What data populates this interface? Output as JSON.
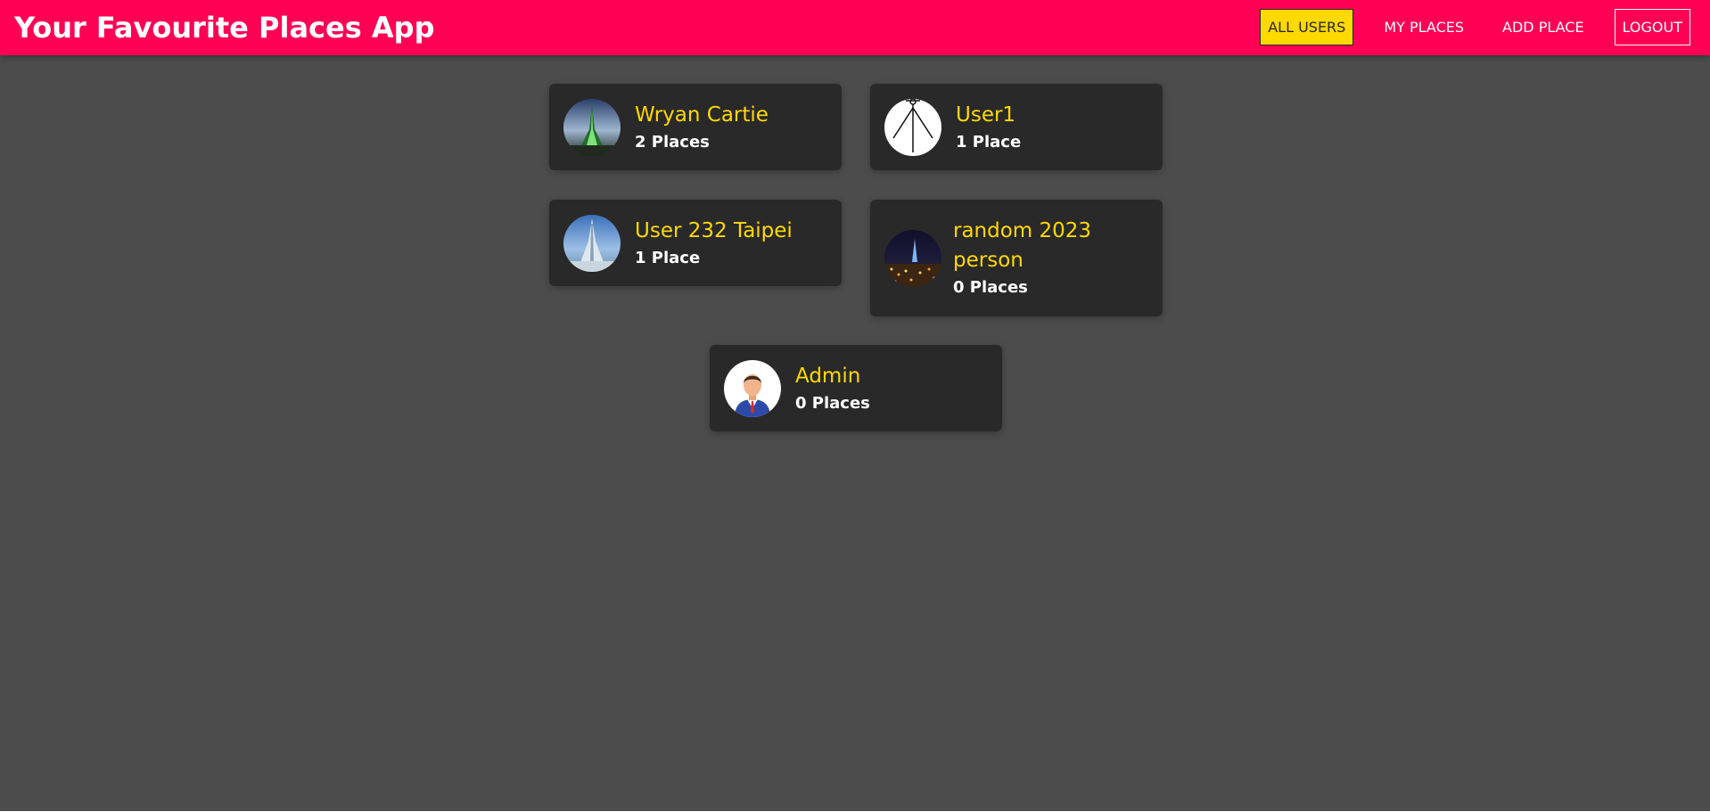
{
  "header": {
    "title": "Your Favourite Places App",
    "nav": [
      {
        "label": "ALL USERS"
      },
      {
        "label": "MY PLACES"
      },
      {
        "label": "ADD PLACE"
      },
      {
        "label": "LOGOUT"
      }
    ]
  },
  "users": [
    {
      "name": "Wryan Cartie",
      "places": "2 Places",
      "avatar": "night-tower-photo"
    },
    {
      "name": "User1",
      "places": "1 Place",
      "avatar": "stick-drawing"
    },
    {
      "name": "User 232 Taipei",
      "places": "1 Place",
      "avatar": "tower-sky-photo"
    },
    {
      "name": "random 2023 person",
      "places": "0 Places",
      "avatar": "city-night-photo"
    },
    {
      "name": "Admin",
      "places": "0 Places",
      "avatar": "man-in-suit-illustration"
    }
  ],
  "colors": {
    "header": "#ff0055",
    "accent": "#ffd900",
    "card": "#292929",
    "background": "#4c4c4c"
  }
}
